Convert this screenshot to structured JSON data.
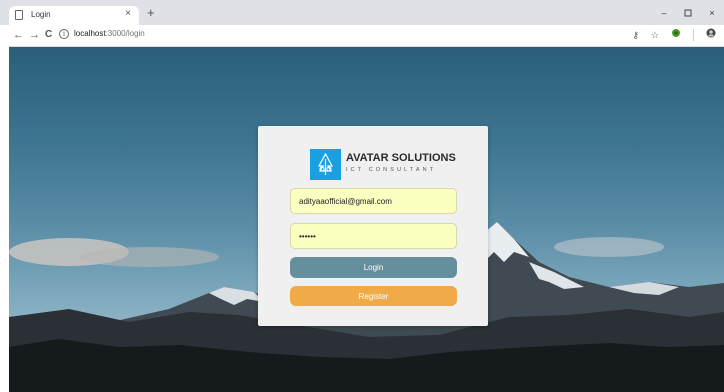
{
  "browser": {
    "tab": {
      "title": "Login",
      "close_glyph": "×"
    },
    "new_tab_glyph": "+",
    "window_controls": {
      "minimize": "–",
      "maximize": "ⓓ",
      "close": "×"
    },
    "nav": {
      "back": "←",
      "forward": "→",
      "reload": "C"
    },
    "address": {
      "host": "localhost",
      "path": ":3000/login",
      "info_glyph": "i"
    },
    "toolbar_icons": {
      "key": "⚷",
      "star": "☆"
    }
  },
  "login": {
    "brand_name": "AVATAR SOLUTIONS",
    "brand_tagline": "ICT CONSULTANT",
    "email_value": "adityaaofficial@gmail.com",
    "password_value": "••••••",
    "login_label": "Login",
    "register_label": "Register"
  },
  "colors": {
    "login_button": "#668f9d",
    "register_button": "#f0aa47",
    "input_background": "#fbffbf",
    "logo_mark": "#1aa0e0"
  }
}
